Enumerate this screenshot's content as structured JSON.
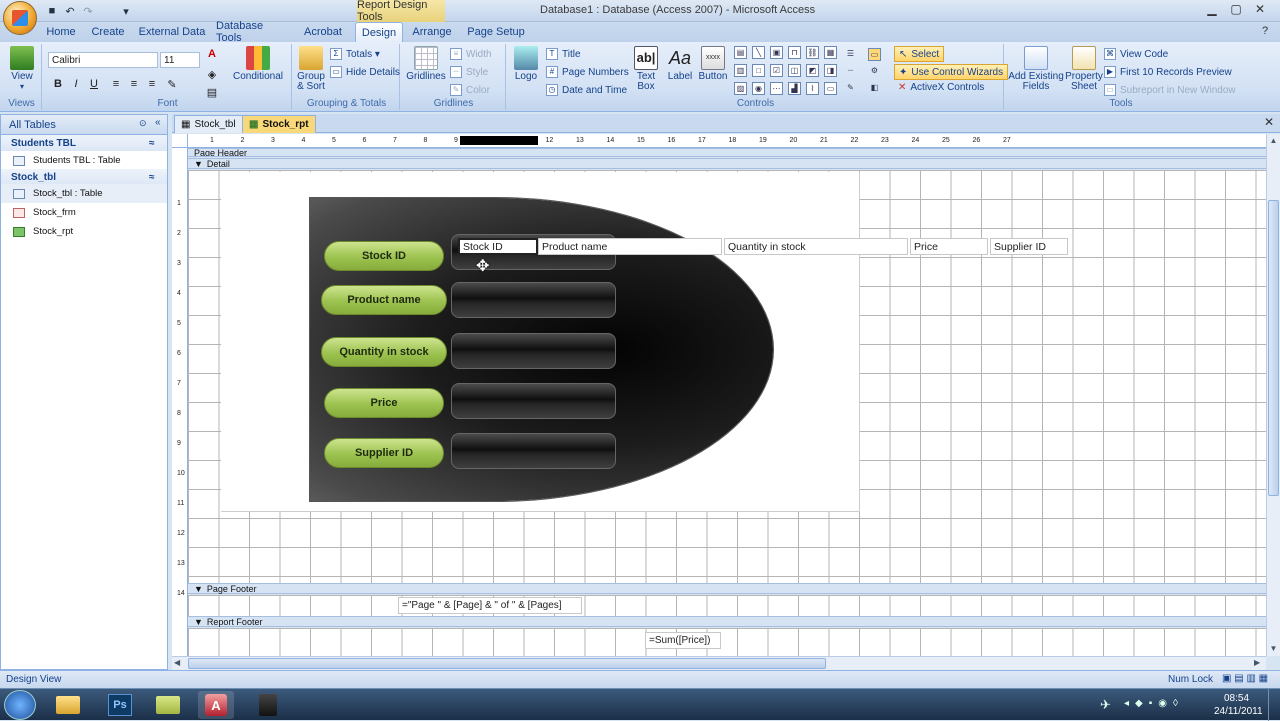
{
  "window": {
    "title": "Database1 : Database (Access 2007) - Microsoft Access",
    "context_tab": "Report Design Tools"
  },
  "ribbon_tabs": [
    "Home",
    "Create",
    "External Data",
    "Database Tools",
    "Acrobat",
    "Design",
    "Arrange",
    "Page Setup"
  ],
  "active_tab": "Design",
  "ribbon": {
    "views": {
      "view_label": "View",
      "group": "Views"
    },
    "font": {
      "font_name": "Calibri",
      "font_size": "11",
      "conditional": "Conditional",
      "group": "Font"
    },
    "grouping": {
      "group_sort": "Group\n& Sort",
      "totals": "Totals",
      "hide_details": "Hide Details",
      "group": "Grouping & Totals"
    },
    "gridlines": {
      "gridlines": "Gridlines",
      "width": "Width",
      "style": "Style",
      "color": "Color",
      "group": "Gridlines"
    },
    "controls": {
      "logo": "Logo",
      "title": "Title",
      "page_numbers": "Page Numbers",
      "date_time": "Date and Time",
      "text_box": "Text\nBox",
      "label": "Label",
      "button": "Button",
      "select": "Select",
      "use_wizards": "Use Control Wizards",
      "activex": "ActiveX Controls",
      "group": "Controls"
    },
    "tools": {
      "add_fields": "Add Existing\nFields",
      "property_sheet": "Property\nSheet",
      "view_code": "View Code",
      "first10": "First 10 Records Preview",
      "subreport": "Subreport in New Window",
      "group": "Tools"
    }
  },
  "nav": {
    "header": "All Tables",
    "groups": [
      {
        "name": "Students TBL",
        "items": [
          {
            "label": "Students TBL : Table"
          }
        ]
      },
      {
        "name": "Stock_tbl",
        "items": [
          {
            "label": "Stock_tbl : Table"
          },
          {
            "label": "Stock_frm"
          },
          {
            "label": "Stock_rpt"
          }
        ]
      }
    ]
  },
  "doc_tabs": [
    "Stock_tbl",
    "Stock_rpt"
  ],
  "sections": {
    "page_header": "Page Header",
    "detail": "Detail",
    "page_footer": "Page Footer",
    "report_footer": "Report Footer"
  },
  "labels": [
    "Stock ID",
    "Product name",
    "Quantity in stock",
    "Price",
    "Supplier ID"
  ],
  "fields": [
    "Stock ID",
    "Product name",
    "Quantity in stock",
    "Price",
    "Supplier ID"
  ],
  "page_footer_expr": "=\"Page \" & [Page] & \" of \" & [Pages]",
  "report_footer_expr": "=Sum([Price])",
  "status": {
    "left": "Design View",
    "right": "Num Lock"
  },
  "clock": {
    "time": "08:54",
    "date": "24/11/2011"
  },
  "colors": {
    "pill_green": "#9cc24f",
    "context_gold": "#e8d27a",
    "ribbon_blue": "#d2e1f4"
  }
}
